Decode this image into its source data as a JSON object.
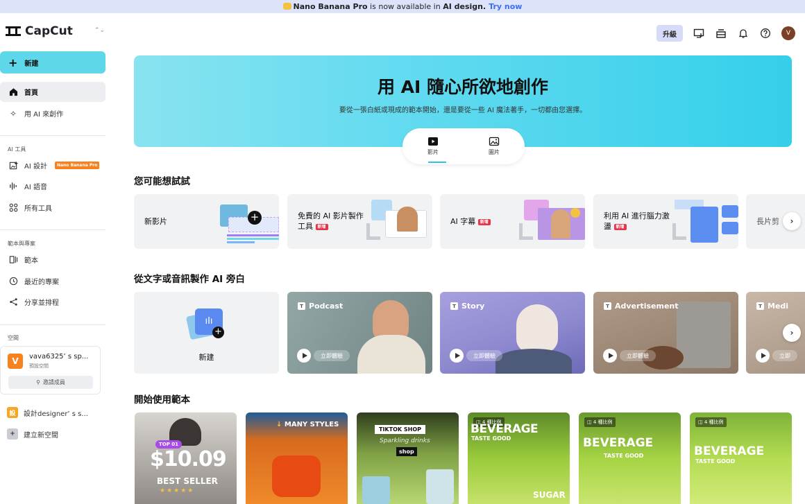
{
  "banner": {
    "product": "Nano Banana Pro",
    "middle": " is now available in ",
    "place": "AI design.",
    "cta": "Try now"
  },
  "brand": {
    "name": "CapCut"
  },
  "sidebar": {
    "new_label": "新建",
    "home": "首頁",
    "create_ai": "用 AI 來創作",
    "ai_tools_header": "AI 工具",
    "ai_design": "AI 設計",
    "ai_design_badge": "Nano Banana Pro",
    "ai_voice": "AI 語音",
    "all_tools": "所有工具",
    "templates_header": "範本與專案",
    "templates": "範本",
    "recent": "最近的專案",
    "share": "分享並排程",
    "space_header": "空間",
    "space": {
      "avatar": "V",
      "name": "vava6325’ s sp...",
      "sub": "預設空間",
      "invite": "邀請成員"
    },
    "workspace_designer": "設計designer’ s s...",
    "new_space": "建立新空間"
  },
  "header": {
    "upgrade": "升級",
    "avatar": "V"
  },
  "hero": {
    "title": "用 AI 隨心所欲地創作",
    "subtitle": "要從一張白紙或現成的範本開始，還是要從一些 AI 魔法著手，一切都由您選擇。",
    "tabs": [
      {
        "label": "影片"
      },
      {
        "label": "圖片"
      }
    ]
  },
  "suggest": {
    "title": "您可能想試試",
    "cards": [
      {
        "label": "新影片",
        "tag": ""
      },
      {
        "label": "免費的 AI 影片製作工具",
        "tag": "新增"
      },
      {
        "label": "AI 字幕",
        "tag": "新增"
      },
      {
        "label": "利用 AI 進行腦力激盪",
        "tag": "新增"
      },
      {
        "label": "長片剪",
        "tag": ""
      }
    ]
  },
  "narration": {
    "title": "從文字或音訊製作 AI 旁白",
    "new_label": "新建",
    "cards": [
      {
        "tag": "Podcast",
        "cta": "立即體驗"
      },
      {
        "tag": "Story",
        "cta": "立即體驗"
      },
      {
        "tag": "Advertisement",
        "cta": "立即體驗"
      },
      {
        "tag": "Medi",
        "cta": "立即"
      }
    ]
  },
  "templates": {
    "title": "開始使用範本",
    "cards": [
      {
        "top": "TOP 01",
        "price": "$10.09",
        "caption": "BEST SELLER"
      },
      {
        "caption": "MANY STYLES"
      },
      {
        "caption": "TIKTOK SHOP",
        "sub": "Sparkling drinks",
        "cta": "shop"
      },
      {
        "ratio": "4 種比例",
        "caption": "BEVERAGE",
        "sub": "TASTE GOOD",
        "extra": "SUGAR"
      },
      {
        "ratio": "4 種比例",
        "caption": "BEVERAGE",
        "sub": "TASTE GOOD"
      },
      {
        "ratio": "4 種比例",
        "caption": "BEVERAGE",
        "sub": "TASTE GOOD"
      }
    ]
  }
}
